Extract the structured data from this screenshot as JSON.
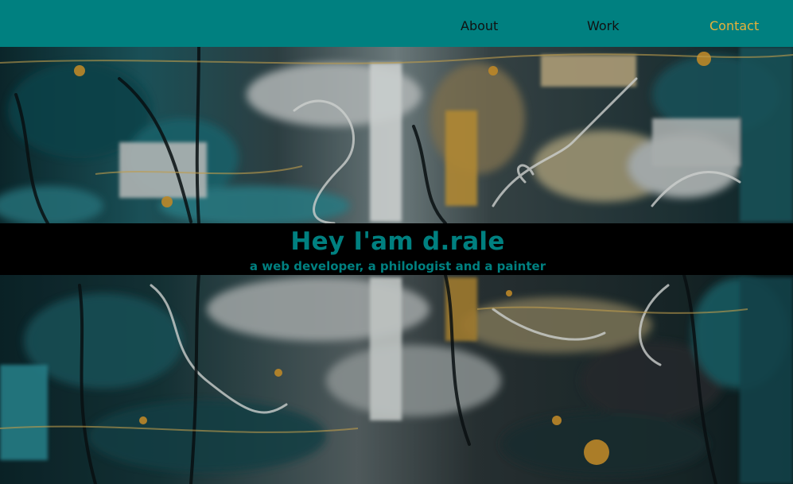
{
  "nav": {
    "links": [
      {
        "label": "About",
        "active": false
      },
      {
        "label": "Work",
        "active": false
      },
      {
        "label": "Contact",
        "active": true
      }
    ]
  },
  "hero": {
    "title": "Hey I'am d.rale",
    "subtitle": "a web developer, a philologist and a painter"
  },
  "colors": {
    "nav_background": "#008080",
    "nav_text": "#111111",
    "nav_active": "#e6b13a",
    "banner_background": "#000000",
    "banner_text": "#008080"
  }
}
